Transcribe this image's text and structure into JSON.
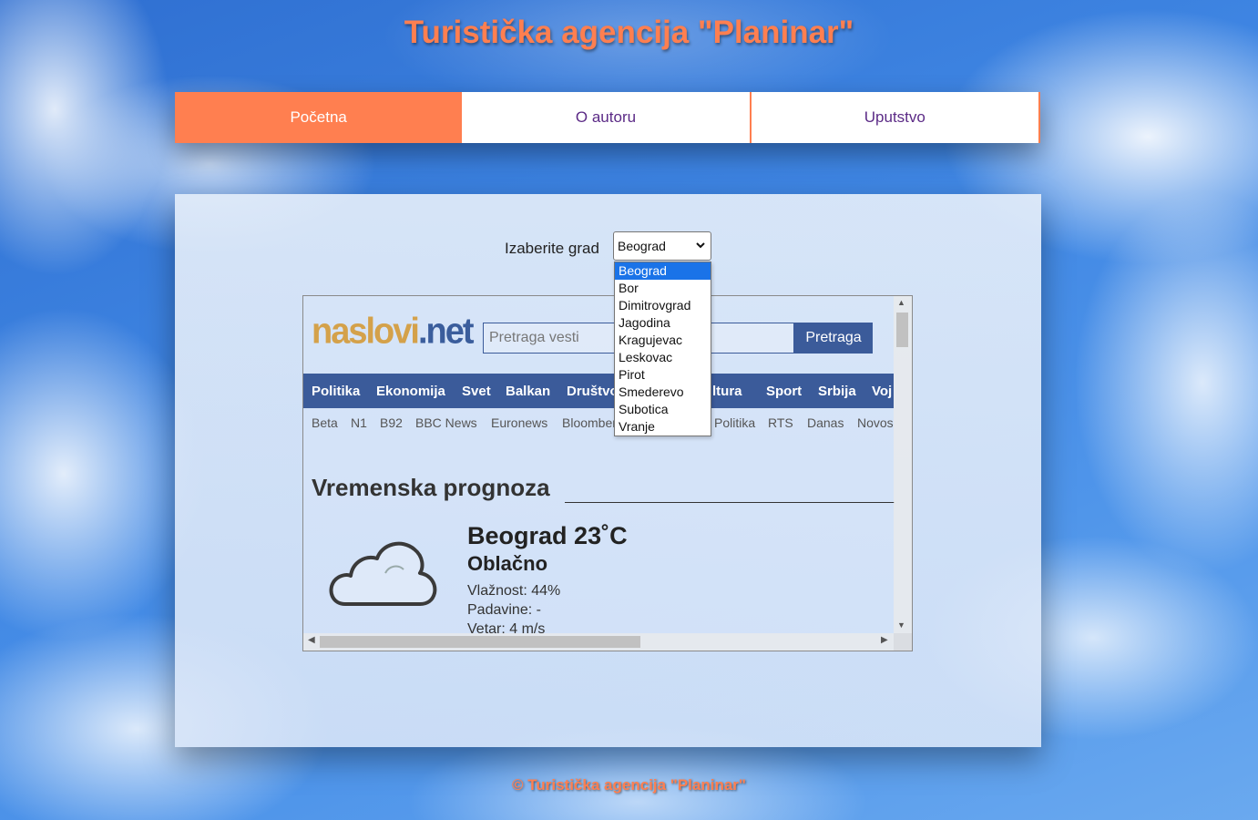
{
  "site": {
    "title": "Turistička agencija \"Planinar\"",
    "footer": "© Turistička agencija \"Planinar\""
  },
  "nav": {
    "tabs": [
      {
        "label": "Početna",
        "active": true
      },
      {
        "label": "O autoru",
        "active": false
      },
      {
        "label": "Uputstvo",
        "active": false
      }
    ]
  },
  "city_picker": {
    "label": "Izaberite grad",
    "selected": "Beograd",
    "options": [
      "Beograd",
      "Bor",
      "Dimitrovgrad",
      "Jagodina",
      "Kragujevac",
      "Leskovac",
      "Pirot",
      "Smederevo",
      "Subotica",
      "Vranje"
    ]
  },
  "widget": {
    "logo_part1": "naslovi",
    "logo_part2": ".net",
    "search_placeholder": "Pretraga vesti",
    "search_button": "Pretraga",
    "categories": [
      "Politika",
      "Ekonomija",
      "Svet",
      "Balkan",
      "Društvo",
      "Kultura",
      "Sport",
      "Srbija",
      "Voj"
    ],
    "sources": [
      "Beta",
      "N1",
      "B92",
      "BBC News",
      "Euronews",
      "Bloomberg",
      "Politika",
      "RTS",
      "Danas",
      "Novos"
    ],
    "weather_heading": "Vremenska prognoza",
    "city": "Beograd",
    "temperature": "23˚C",
    "condition": "Oblačno",
    "humidity": "Vlažnost: 44%",
    "precipitation": "Padavine: -",
    "wind": "Vetar: 4 m/s"
  },
  "colors": {
    "accent": "#ff7f50",
    "widget_blue": "#3b5b9a",
    "logo_gold": "#d4a14a",
    "selected_option": "#1a73e8"
  }
}
